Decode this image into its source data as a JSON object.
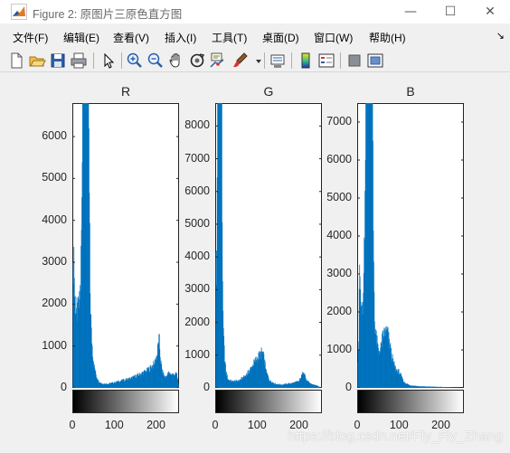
{
  "window": {
    "title": "Figure 2: 原图片三原色直方图",
    "minimize_glyph": "—",
    "maximize_glyph": "☐",
    "close_glyph": "✕"
  },
  "menu": {
    "items": [
      "文件(F)",
      "编辑(E)",
      "查看(V)",
      "插入(I)",
      "工具(T)",
      "桌面(D)",
      "窗口(W)",
      "帮助(H)"
    ],
    "overflow_glyph": "↘"
  },
  "toolbar": {
    "buttons": [
      "new-figure-icon",
      "open-file-icon",
      "save-icon",
      "print-icon",
      "pointer-icon",
      "zoom-in-icon",
      "zoom-out-icon",
      "pan-hand-icon",
      "rotate-3d-icon",
      "data-cursor-icon",
      "brush-icon",
      "brush-dropdown-icon",
      "link-plot-icon",
      "colorbar-icon",
      "legend-icon",
      "hide-plot-tools-icon",
      "show-plot-tools-icon"
    ]
  },
  "colors": {
    "bar": "#0072bd",
    "axis": "#262626"
  },
  "chart_data": [
    {
      "type": "bar",
      "title": "R",
      "xlim": [
        0,
        255
      ],
      "ylim": [
        0,
        6800
      ],
      "yticks": [
        "0",
        "1000",
        "2000",
        "3000",
        "4000",
        "5000",
        "6000"
      ],
      "xticks": [
        "0",
        "100",
        "200"
      ],
      "profile": [
        [
          0,
          0
        ],
        [
          1,
          2600
        ],
        [
          3,
          3300
        ],
        [
          5,
          2200
        ],
        [
          8,
          1900
        ],
        [
          12,
          1800
        ],
        [
          16,
          2000
        ],
        [
          19,
          2500
        ],
        [
          22,
          4300
        ],
        [
          24,
          6800
        ],
        [
          38,
          6800
        ],
        [
          40,
          4500
        ],
        [
          42,
          2300
        ],
        [
          45,
          1300
        ],
        [
          48,
          850
        ],
        [
          52,
          500
        ],
        [
          57,
          280
        ],
        [
          63,
          150
        ],
        [
          72,
          100
        ],
        [
          85,
          100
        ],
        [
          100,
          130
        ],
        [
          120,
          180
        ],
        [
          140,
          230
        ],
        [
          160,
          320
        ],
        [
          180,
          420
        ],
        [
          195,
          560
        ],
        [
          203,
          800
        ],
        [
          206,
          1150
        ],
        [
          208,
          1100
        ],
        [
          211,
          650
        ],
        [
          215,
          380
        ],
        [
          222,
          250
        ],
        [
          230,
          350
        ],
        [
          240,
          320
        ],
        [
          250,
          330
        ],
        [
          255,
          0
        ]
      ]
    },
    {
      "type": "bar",
      "title": "G",
      "xlim": [
        0,
        255
      ],
      "ylim": [
        0,
        8700
      ],
      "yticks": [
        "0",
        "1000",
        "2000",
        "3000",
        "4000",
        "5000",
        "6000",
        "7000",
        "8000"
      ],
      "xticks": [
        "0",
        "100",
        "200"
      ],
      "profile": [
        [
          0,
          0
        ],
        [
          1,
          3800
        ],
        [
          2,
          4100
        ],
        [
          3,
          3200
        ],
        [
          4,
          7000
        ],
        [
          5,
          8700
        ],
        [
          15,
          8700
        ],
        [
          16,
          5200
        ],
        [
          18,
          2000
        ],
        [
          20,
          1400
        ],
        [
          22,
          900
        ],
        [
          25,
          500
        ],
        [
          30,
          260
        ],
        [
          40,
          200
        ],
        [
          55,
          220
        ],
        [
          65,
          300
        ],
        [
          75,
          420
        ],
        [
          85,
          600
        ],
        [
          95,
          820
        ],
        [
          105,
          980
        ],
        [
          112,
          1100
        ],
        [
          117,
          850
        ],
        [
          122,
          480
        ],
        [
          130,
          220
        ],
        [
          145,
          120
        ],
        [
          160,
          100
        ],
        [
          185,
          150
        ],
        [
          200,
          200
        ],
        [
          207,
          380
        ],
        [
          211,
          560
        ],
        [
          214,
          430
        ],
        [
          218,
          220
        ],
        [
          230,
          120
        ],
        [
          245,
          60
        ],
        [
          255,
          0
        ]
      ]
    },
    {
      "type": "bar",
      "title": "B",
      "xlim": [
        0,
        255
      ],
      "ylim": [
        0,
        7500
      ],
      "yticks": [
        "0",
        "1000",
        "2000",
        "3000",
        "4000",
        "5000",
        "6000",
        "7000"
      ],
      "xticks": [
        "0",
        "100",
        "200"
      ],
      "profile": [
        [
          0,
          0
        ],
        [
          1,
          800
        ],
        [
          3,
          1300
        ],
        [
          5,
          3200
        ],
        [
          8,
          2200
        ],
        [
          11,
          1900
        ],
        [
          14,
          2300
        ],
        [
          18,
          4500
        ],
        [
          20,
          7500
        ],
        [
          36,
          7500
        ],
        [
          38,
          4200
        ],
        [
          41,
          1800
        ],
        [
          45,
          1300
        ],
        [
          50,
          1000
        ],
        [
          55,
          1000
        ],
        [
          60,
          1300
        ],
        [
          66,
          1500
        ],
        [
          72,
          1450
        ],
        [
          78,
          1100
        ],
        [
          85,
          700
        ],
        [
          92,
          480
        ],
        [
          100,
          420
        ],
        [
          106,
          280
        ],
        [
          112,
          150
        ],
        [
          125,
          70
        ],
        [
          150,
          40
        ],
        [
          200,
          25
        ],
        [
          255,
          0
        ]
      ]
    }
  ],
  "watermark": "https://blog.csdn.net/Fly_Fly_Zhang"
}
